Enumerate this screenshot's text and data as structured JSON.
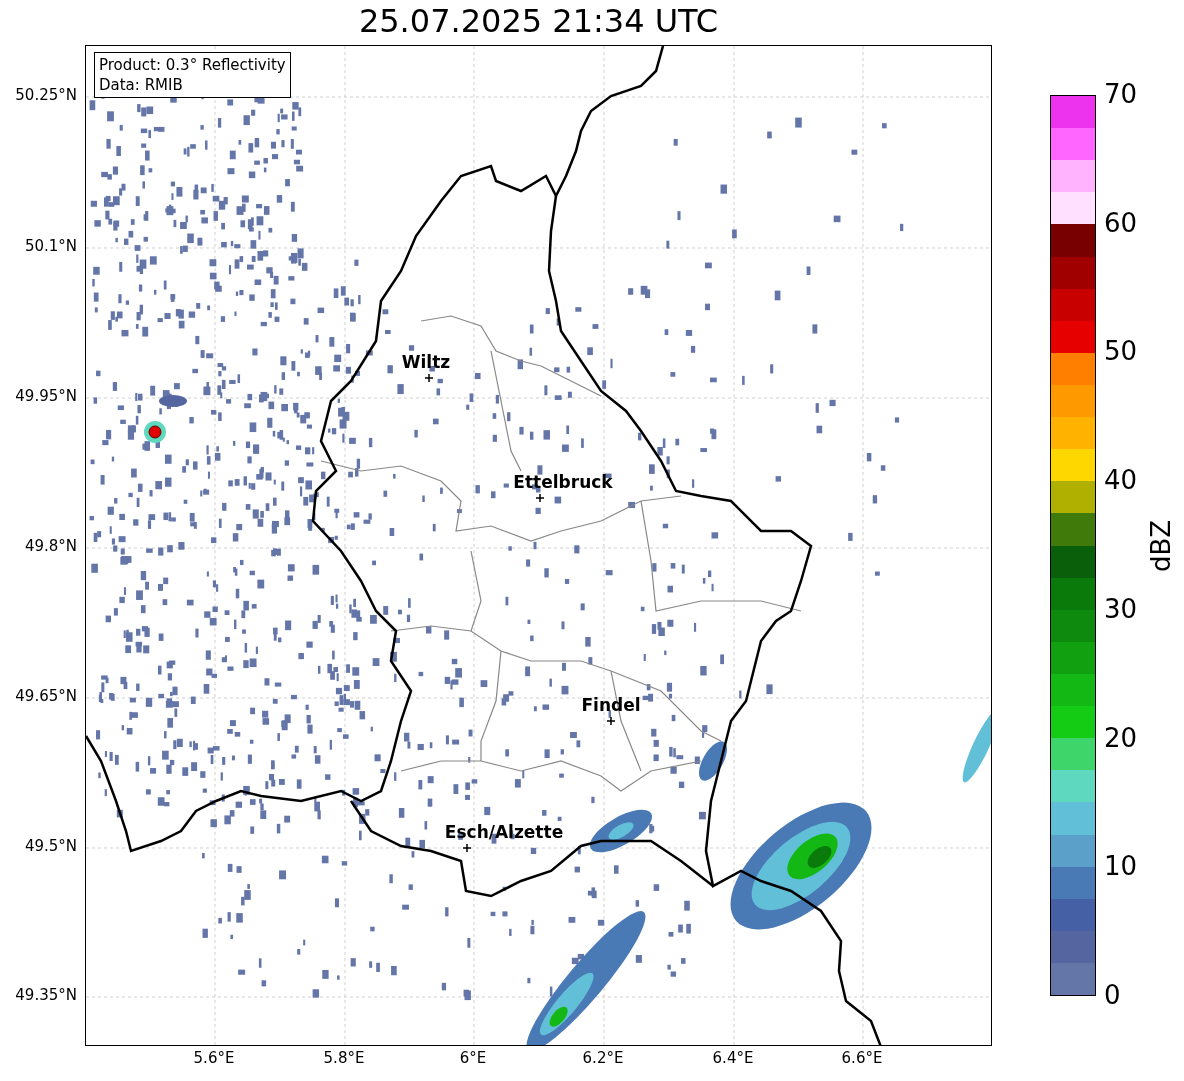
{
  "title": "25.07.2025 21:34 UTC",
  "info_box": [
    "Product: 0.3° Reflectivity",
    "Data: RMIB"
  ],
  "y_ticks": [
    "50.25°N",
    "50.1°N",
    "49.95°N",
    "49.8°N",
    "49.65°N",
    "49.5°N",
    "49.35°N"
  ],
  "x_ticks": [
    "5.6°E",
    "5.8°E",
    "6°E",
    "6.2°E",
    "6.4°E",
    "6.6°E"
  ],
  "cities": [
    {
      "name": "Wiltz"
    },
    {
      "name": "Ettelbruck"
    },
    {
      "name": "Findel"
    },
    {
      "name": "Esch/Alzette"
    }
  ],
  "colorbar": {
    "label": "dBZ",
    "ticks": [
      "70",
      "60",
      "50",
      "40",
      "30",
      "20",
      "10",
      "0"
    ],
    "bins": [
      {
        "color": "#ee33ee"
      },
      {
        "color": "#ff66ff"
      },
      {
        "color": "#ffb3ff"
      },
      {
        "color": "#ffe0ff"
      },
      {
        "color": "#780000"
      },
      {
        "color": "#a00000"
      },
      {
        "color": "#c80000"
      },
      {
        "color": "#e60000"
      },
      {
        "color": "#ff7f00"
      },
      {
        "color": "#ff9900"
      },
      {
        "color": "#ffb300"
      },
      {
        "color": "#ffd700"
      },
      {
        "color": "#b0b000"
      },
      {
        "color": "#3f7a0a"
      },
      {
        "color": "#0a5f0a"
      },
      {
        "color": "#0a7a0a"
      },
      {
        "color": "#0e8a0e"
      },
      {
        "color": "#10a010"
      },
      {
        "color": "#14b814"
      },
      {
        "color": "#14cc14"
      },
      {
        "color": "#3ed66a"
      },
      {
        "color": "#5fd8c0"
      },
      {
        "color": "#62bfd8"
      },
      {
        "color": "#5ba0c8"
      },
      {
        "color": "#4a7ab5"
      },
      {
        "color": "#4560a5"
      },
      {
        "color": "#5565a0"
      },
      {
        "color": "#6475a8"
      }
    ]
  }
}
